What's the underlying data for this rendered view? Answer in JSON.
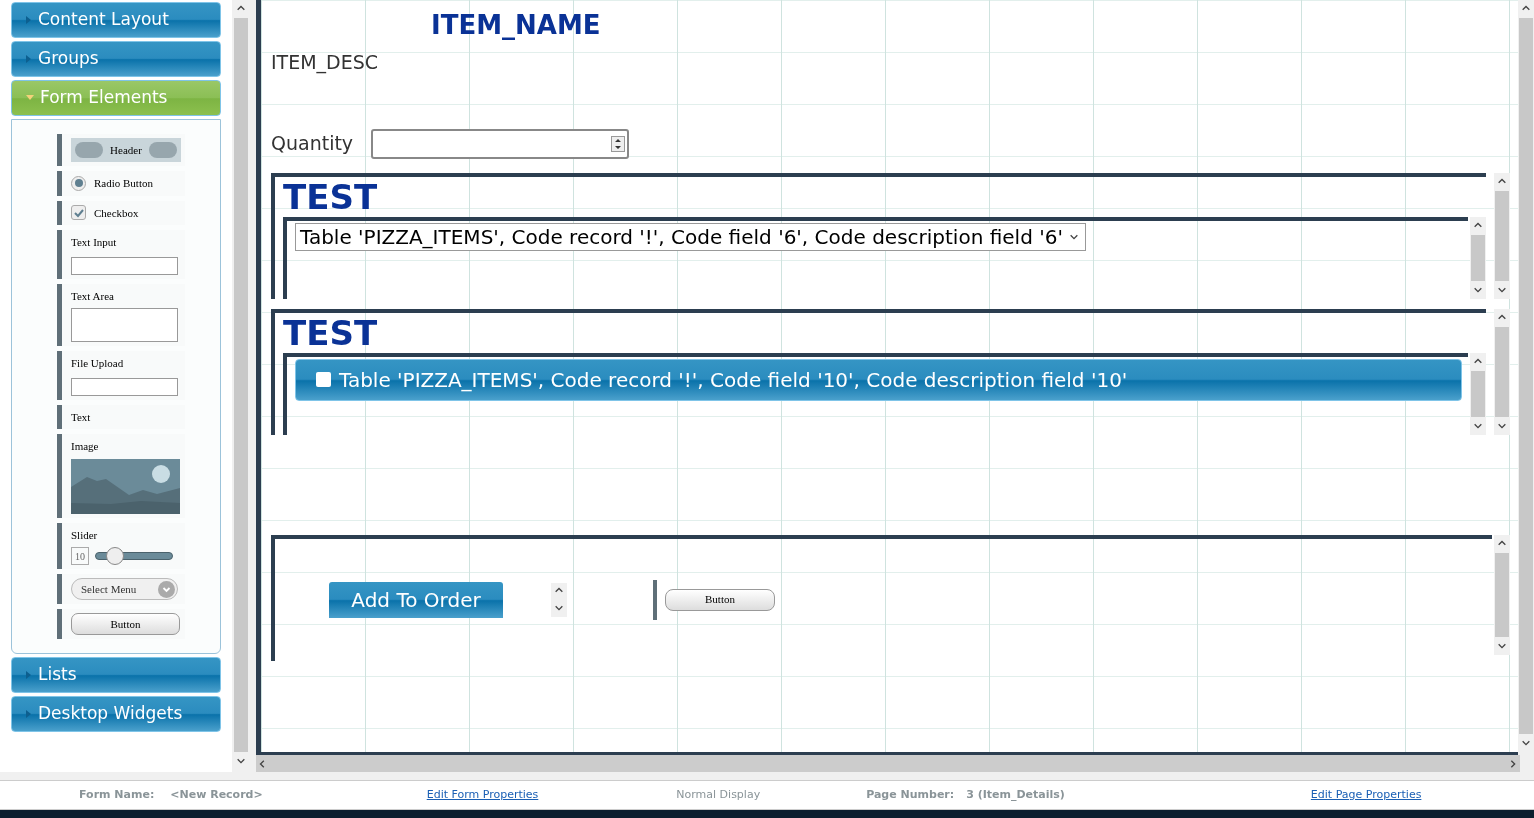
{
  "sidebar": {
    "sections": [
      {
        "label": "Content Layout",
        "expanded": false
      },
      {
        "label": "Groups",
        "expanded": false
      },
      {
        "label": "Form Elements",
        "expanded": true,
        "items": [
          {
            "kind": "header",
            "label": "Header"
          },
          {
            "kind": "radio",
            "label": "Radio Button",
            "checked": true
          },
          {
            "kind": "checkbox",
            "label": "Checkbox",
            "checked": true
          },
          {
            "kind": "text_input",
            "label": "Text Input"
          },
          {
            "kind": "text_area",
            "label": "Text Area"
          },
          {
            "kind": "file_upload",
            "label": "File Upload"
          },
          {
            "kind": "text",
            "label": "Text"
          },
          {
            "kind": "image",
            "label": "Image"
          },
          {
            "kind": "slider",
            "label": "Slider",
            "value": "10",
            "level": 0.25
          },
          {
            "kind": "select",
            "label": "Select Menu"
          },
          {
            "kind": "button",
            "label": "Button"
          }
        ]
      },
      {
        "label": "Lists",
        "expanded": false
      },
      {
        "label": "Desktop Widgets",
        "expanded": false
      }
    ]
  },
  "canvas": {
    "title": "ITEM_NAME",
    "description": "ITEM_DESC",
    "quantity": {
      "label": "Quantity"
    },
    "sections": [
      {
        "kind": "dropdown",
        "title": "TEST",
        "value": "Table 'PIZZA_ITEMS', Code record '!', Code field '6', Code description field '6'"
      },
      {
        "kind": "checklist",
        "title": "TEST",
        "items": [
          {
            "label": "Table 'PIZZA_ITEMS', Code record '!', Code field '10', Code description field '10'",
            "checked": false
          }
        ]
      },
      {
        "kind": "buttons",
        "primary": "Add To Order",
        "secondary": "Button"
      }
    ]
  },
  "status_bar": {
    "form_name_label": "Form Name:",
    "form_name": "<New Record>",
    "edit_form": "Edit Form Properties",
    "display": "Normal Display",
    "page_number_label": "Page Number:",
    "page_number": "3 (Item_Details)",
    "edit_page": "Edit Page Properties"
  }
}
